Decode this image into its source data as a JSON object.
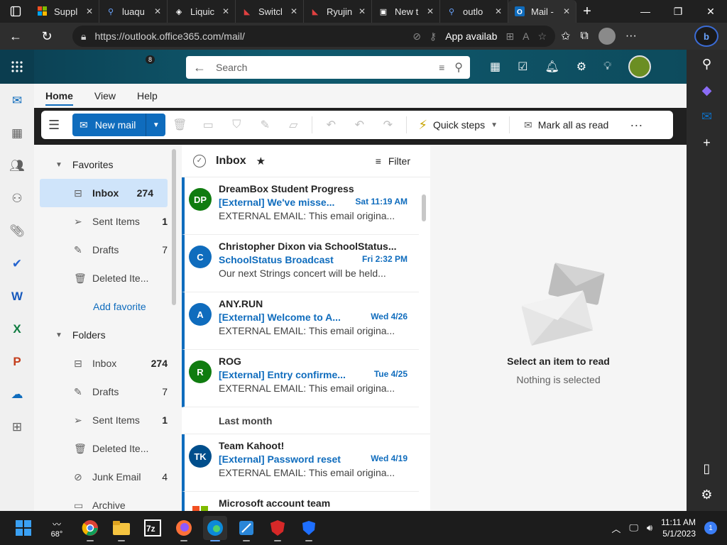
{
  "browser": {
    "tabs": [
      {
        "title": "Suppl",
        "icon": "microsoft-icon"
      },
      {
        "title": "luaqu",
        "icon": "search-icon"
      },
      {
        "title": "Liquic",
        "icon": "liquid-icon"
      },
      {
        "title": "Switcl",
        "icon": "switch-icon"
      },
      {
        "title": "Ryujin",
        "icon": "ryujinx-icon"
      },
      {
        "title": "New t",
        "icon": "newtab-icon"
      },
      {
        "title": "outlo",
        "icon": "search-icon"
      },
      {
        "title": "Mail -",
        "icon": "outlook-icon"
      }
    ],
    "url": "https://outlook.office365.com/mail/",
    "app_available": "App availab"
  },
  "outlook": {
    "search_placeholder": "Search",
    "notification_count": "8",
    "ribbon_tabs": [
      "Home",
      "View",
      "Help"
    ],
    "toolbar": {
      "new_mail": "New mail",
      "quick_steps": "Quick steps",
      "mark_all_read": "Mark all as read",
      "more": "···"
    },
    "favorites_label": "Favorites",
    "favorites": [
      {
        "label": "Inbox",
        "count": "274",
        "icon": "inbox-icon"
      },
      {
        "label": "Sent Items",
        "count": "1",
        "icon": "sent-icon"
      },
      {
        "label": "Drafts",
        "count": "7",
        "icon": "drafts-icon"
      },
      {
        "label": "Deleted Ite...",
        "count": "",
        "icon": "trash-icon"
      }
    ],
    "add_favorite": "Add favorite",
    "folders_label": "Folders",
    "folders": [
      {
        "label": "Inbox",
        "count": "274",
        "icon": "inbox-icon"
      },
      {
        "label": "Drafts",
        "count": "7",
        "icon": "drafts-icon"
      },
      {
        "label": "Sent Items",
        "count": "1",
        "icon": "sent-icon"
      },
      {
        "label": "Deleted Ite...",
        "count": "",
        "icon": "trash-icon"
      },
      {
        "label": "Junk Email",
        "count": "4",
        "icon": "junk-icon"
      },
      {
        "label": "Archive",
        "count": "",
        "icon": "archive-icon"
      }
    ],
    "list": {
      "title": "Inbox",
      "filter": "Filter",
      "messages": [
        {
          "initials": "DP",
          "color": "#107c10",
          "sender": "DreamBox Student Progress",
          "subject": "[External] We've misse...",
          "time": "Sat 11:19 AM",
          "preview": "EXTERNAL EMAIL: This email origina..."
        },
        {
          "initials": "C",
          "color": "#0f6cbd",
          "sender": "Christopher Dixon via SchoolStatus...",
          "subject": "SchoolStatus Broadcast",
          "time": "Fri 2:32 PM",
          "preview": "Our next Strings concert will be held..."
        },
        {
          "initials": "A",
          "color": "#0f6cbd",
          "sender": "ANY.RUN",
          "subject": "[External] Welcome to A...",
          "time": "Wed 4/26",
          "preview": "EXTERNAL EMAIL: This email origina..."
        },
        {
          "initials": "R",
          "color": "#107c10",
          "sender": "ROG",
          "subject": "[External] Entry confirme...",
          "time": "Tue 4/25",
          "preview": "EXTERNAL EMAIL: This email origina..."
        }
      ],
      "group_label": "Last month",
      "messages2": [
        {
          "initials": "TK",
          "color": "#004e8c",
          "sender": "Team Kahoot!",
          "subject": "[External] Password reset",
          "time": "Wed 4/19",
          "preview": "EXTERNAL EMAIL: This email origina..."
        },
        {
          "initials": "",
          "color": "#ffffff",
          "sender": "Microsoft account team",
          "subject": "",
          "time": "",
          "preview": ""
        }
      ]
    },
    "reading": {
      "title": "Select an item to read",
      "subtitle": "Nothing is selected"
    }
  },
  "taskbar": {
    "weather": "68°",
    "time": "11:11 AM",
    "date": "5/1/2023",
    "notifications": "1"
  }
}
